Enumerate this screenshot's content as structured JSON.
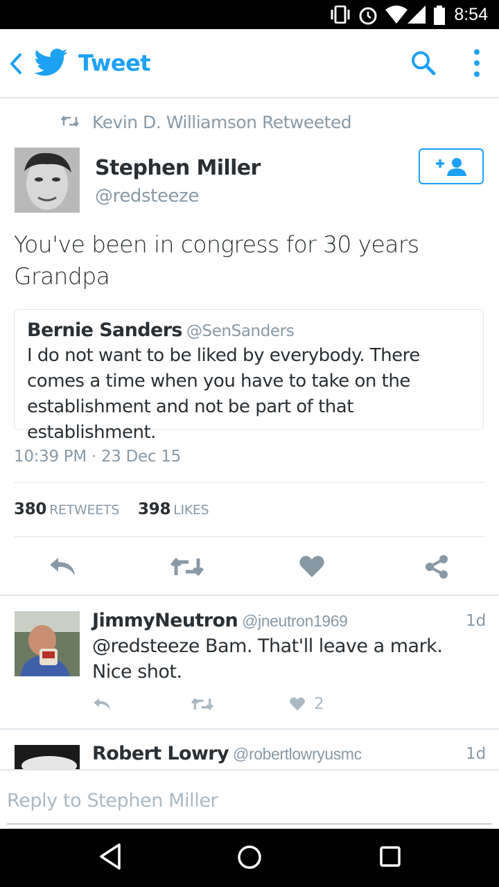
{
  "status_bar": {
    "time": "8:54"
  },
  "app_bar": {
    "title": "Tweet"
  },
  "tweet": {
    "retweet_context": "Kevin D. Williamson Retweeted",
    "author_name": "Stephen Miller",
    "author_handle": "@redsteeze",
    "text": "You've been in congress for 30 years Grandpa",
    "quoted": {
      "name": "Bernie Sanders",
      "handle": "@SenSanders",
      "text": "I do not want to be liked by everybody. There comes a time when you have to take on the establishment and not be part of that establishment."
    },
    "timestamp": "10:39 PM · 23 Dec 15",
    "retweets_count": "380",
    "retweets_label": "RETWEETS",
    "likes_count": "398",
    "likes_label": "LIKES"
  },
  "replies": [
    {
      "name": "JimmyNeutron",
      "handle": "@jneutron1969",
      "time": "1d",
      "text": "@redsteeze Bam. That'll leave a mark. Nice shot.",
      "likes": "2"
    },
    {
      "name": "Robert Lowry",
      "handle": "@robertlowryusmc",
      "time": "1d"
    }
  ],
  "composer": {
    "placeholder": "Reply to Stephen Miller"
  },
  "colors": {
    "brand": "#1da1f2",
    "muted": "#8899a6",
    "text": "#292f33",
    "divider": "#e1e8ed",
    "icon_gray": "#aab8c2"
  },
  "icons": [
    "back-icon",
    "twitter-bird-icon",
    "search-icon",
    "overflow-menu-icon",
    "retweet-icon",
    "follow-icon",
    "reply-icon",
    "like-icon",
    "share-icon"
  ]
}
